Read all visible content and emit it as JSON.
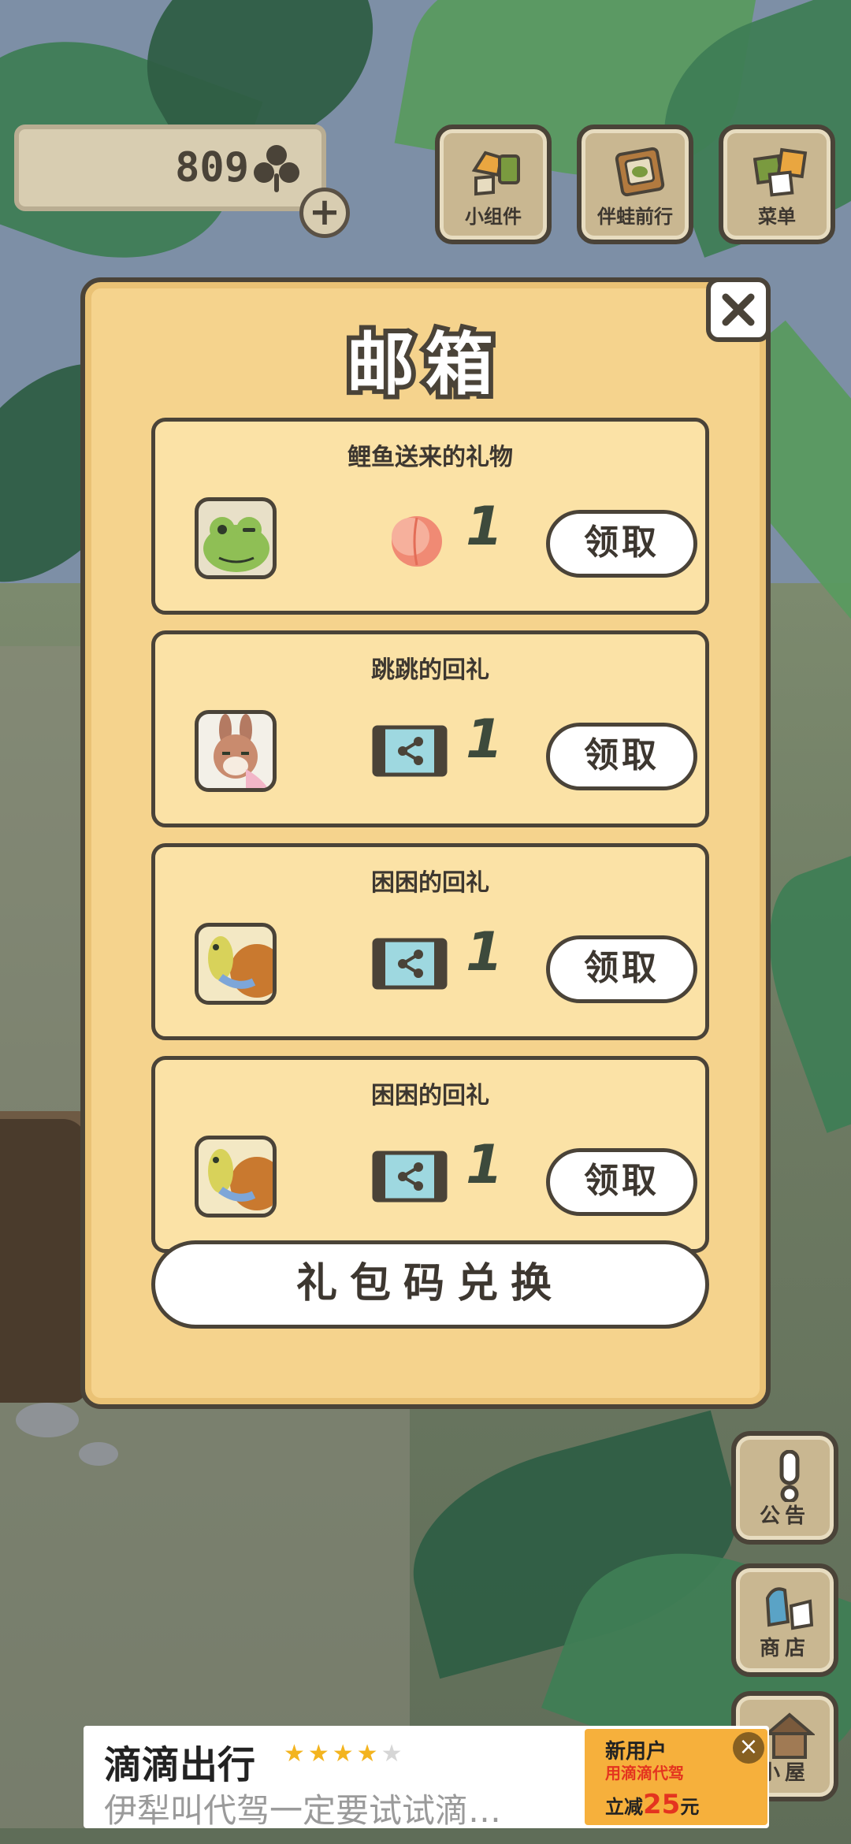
{
  "hud": {
    "clover_count": "809",
    "top_buttons": [
      {
        "label": "小组件",
        "icon": "widget-icon"
      },
      {
        "label": "伴蛙前行",
        "icon": "frog-journey-icon"
      },
      {
        "label": "菜单",
        "icon": "menu-icon"
      }
    ],
    "side_buttons": [
      {
        "label": "公告",
        "icon": "notice-icon"
      },
      {
        "label": "商店",
        "icon": "shop-icon"
      },
      {
        "label": "小屋",
        "icon": "house-icon"
      }
    ]
  },
  "mailbox": {
    "title": "邮箱",
    "claim_label": "领取",
    "items": [
      {
        "title": "鲤鱼送来的礼物",
        "sender": "frog",
        "reward": "peach-icon",
        "count": "1"
      },
      {
        "title": "跳跳的回礼",
        "sender": "rabbit",
        "reward": "film-share-icon",
        "count": "1"
      },
      {
        "title": "困困的回礼",
        "sender": "turtle",
        "reward": "film-share-icon",
        "count": "1"
      },
      {
        "title": "困困的回礼",
        "sender": "turtle",
        "reward": "film-share-icon",
        "count": "1"
      }
    ],
    "redeem_label": "礼包码兑换"
  },
  "ad": {
    "title": "滴滴出行",
    "rating": 4,
    "description": "伊犁叫代驾一定要试试滴…",
    "image_line1": "新用户",
    "image_line2": "用滴滴代驾",
    "image_line3": "立减",
    "image_amount": "25",
    "image_unit": "元"
  },
  "colors": {
    "panel": "#f5d38d",
    "card": "#fbe2a6",
    "outline": "#4a4338",
    "hud_button": "#c9b791"
  }
}
